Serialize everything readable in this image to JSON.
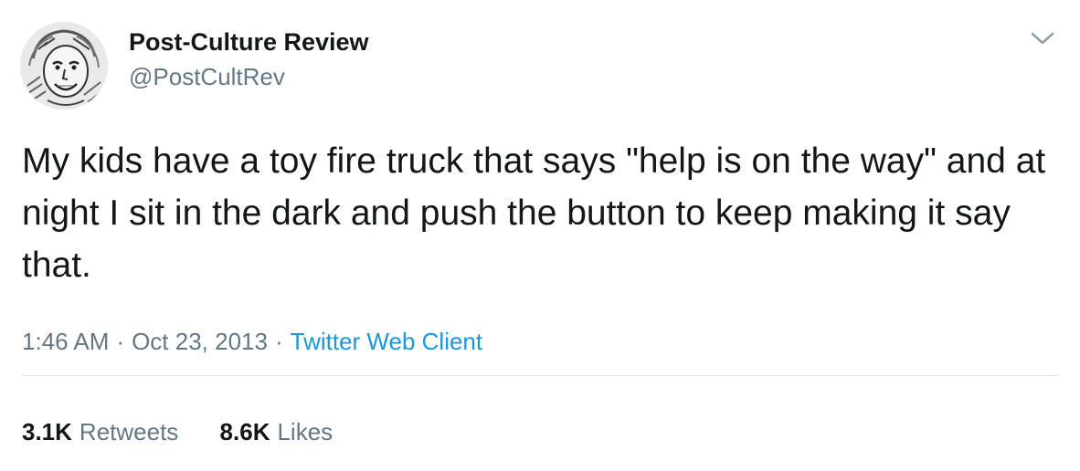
{
  "author": {
    "display_name": "Post-Culture Review",
    "handle": "@PostCultRev",
    "avatar_icon": "avatar-photo"
  },
  "menu": {
    "icon": "chevron-down-icon"
  },
  "tweet": {
    "text": "My kids have a toy fire truck that says \"help is on the way\" and at night I sit in the dark and push the button to keep making it say that.",
    "time": "1:46 AM",
    "date": "Oct 23, 2013",
    "separator": "·",
    "client": "Twitter Web Client"
  },
  "stats": {
    "retweets_count": "3.1K",
    "retweets_label": "Retweets",
    "likes_count": "8.6K",
    "likes_label": "Likes"
  },
  "colors": {
    "text": "#14171a",
    "secondary": "#657786",
    "link": "#1b95e0",
    "divider": "#e1e8ed"
  }
}
